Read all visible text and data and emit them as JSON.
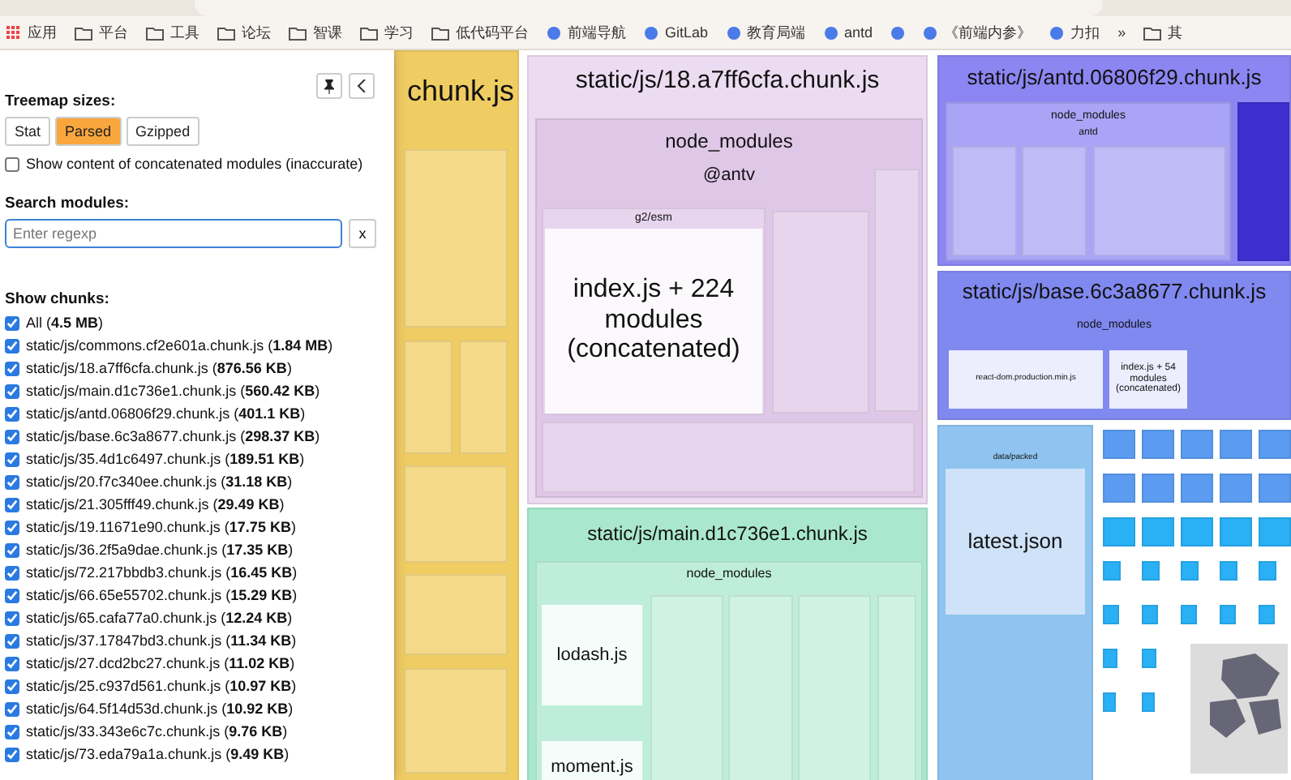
{
  "bookmarks": [
    {
      "label": "应用",
      "kind": "apps"
    },
    {
      "label": "平台",
      "kind": "folder"
    },
    {
      "label": "工具",
      "kind": "folder"
    },
    {
      "label": "论坛",
      "kind": "folder"
    },
    {
      "label": "智课",
      "kind": "folder"
    },
    {
      "label": "学习",
      "kind": "folder"
    },
    {
      "label": "低代码平台",
      "kind": "folder"
    },
    {
      "label": "前端导航",
      "kind": "site"
    },
    {
      "label": "GitLab",
      "kind": "site"
    },
    {
      "label": "教育局端",
      "kind": "site"
    },
    {
      "label": "antd",
      "kind": "site"
    },
    {
      "kind": "site"
    },
    {
      "label": "《前端内参》",
      "kind": "site"
    },
    {
      "label": "力扣",
      "kind": "site"
    }
  ],
  "bookmarks_more": "»",
  "bookmarks_other": "其",
  "sidebar": {
    "sizes_label": "Treemap sizes:",
    "size_buttons": [
      {
        "label": "Stat",
        "selected": false
      },
      {
        "label": "Parsed",
        "selected": true
      },
      {
        "label": "Gzipped",
        "selected": false
      }
    ],
    "concatenated": {
      "label": "Show content of concatenated modules (inaccurate)",
      "checked": false
    },
    "search_label": "Search modules:",
    "search": {
      "placeholder": "Enter regexp"
    },
    "clear_button": "x",
    "chunks_label": "Show chunks:",
    "chunks": [
      {
        "text": "All (**4.5 MB**)",
        "checked": true
      },
      {
        "text": "static/js/commons.cf2e601a.chunk.js (**1.84 MB**)",
        "checked": true
      },
      {
        "text": "static/js/18.a7ff6cfa.chunk.js (**876.56 KB**)",
        "checked": true
      },
      {
        "text": "static/js/main.d1c736e1.chunk.js (**560.42 KB**)",
        "checked": true
      },
      {
        "text": "static/js/antd.06806f29.chunk.js (**401.1 KB**)",
        "checked": true
      },
      {
        "text": "static/js/base.6c3a8677.chunk.js (**298.37 KB**)",
        "checked": true
      },
      {
        "text": "static/js/35.4d1c6497.chunk.js (**189.51 KB**)",
        "checked": true
      },
      {
        "text": "static/js/20.f7c340ee.chunk.js (**31.18 KB**)",
        "checked": true
      },
      {
        "text": "static/js/21.305fff49.chunk.js (**29.49 KB**)",
        "checked": true
      },
      {
        "text": "static/js/19.11671e90.chunk.js (**17.75 KB**)",
        "checked": true
      },
      {
        "text": "static/js/36.2f5a9dae.chunk.js (**17.35 KB**)",
        "checked": true
      },
      {
        "text": "static/js/72.217bbdb3.chunk.js (**16.45 KB**)",
        "checked": true
      },
      {
        "text": "static/js/66.65e55702.chunk.js (**15.29 KB**)",
        "checked": true
      },
      {
        "text": "static/js/65.cafa77a0.chunk.js (**12.24 KB**)",
        "checked": true
      },
      {
        "text": "static/js/37.17847bd3.chunk.js (**11.34 KB**)",
        "checked": true
      },
      {
        "text": "static/js/27.dcd2bc27.chunk.js (**11.02 KB**)",
        "checked": true
      },
      {
        "text": "static/js/25.c937d561.chunk.js (**10.97 KB**)",
        "checked": true
      },
      {
        "text": "static/js/64.5f14d53d.chunk.js (**10.92 KB**)",
        "checked": true
      },
      {
        "text": "static/js/33.343e6c7c.chunk.js (**9.76 KB**)",
        "checked": true
      },
      {
        "text": "static/js/73.eda79a1a.chunk.js (**9.49 KB**)",
        "checked": true
      }
    ]
  },
  "treemap": {
    "commons": {
      "title": "chunk.js",
      "color": "#f0cd62"
    },
    "vendors": {
      "title": "static/js/18.a7ff6cfa.chunk.js",
      "color": "#ecdcf1",
      "node_modules": "node_modules",
      "package": "@antv",
      "folder": "g2/esm",
      "module": "index.js + 224 modules (concatenated)"
    },
    "main": {
      "title": "static/js/main.d1c736e1.chunk.js",
      "color": "#a9e8cf",
      "node_modules": "node_modules",
      "modules": [
        "lodash.js",
        "moment.js"
      ]
    },
    "antd": {
      "title": "static/js/antd.06806f29.chunk.js",
      "color": "#8c86f2",
      "node_modules": "node_modules",
      "package": "antd"
    },
    "base": {
      "title": "static/js/base.6c3a8677.chunk.js",
      "color": "#8089f0",
      "node_modules": "node_modules",
      "modules": [
        "react-dom.production.min.js",
        "index.js + 54 modules (concatenated)"
      ]
    },
    "data": {
      "color": "#8ec4ef",
      "folder": "data/packed",
      "module": "latest.json"
    }
  }
}
